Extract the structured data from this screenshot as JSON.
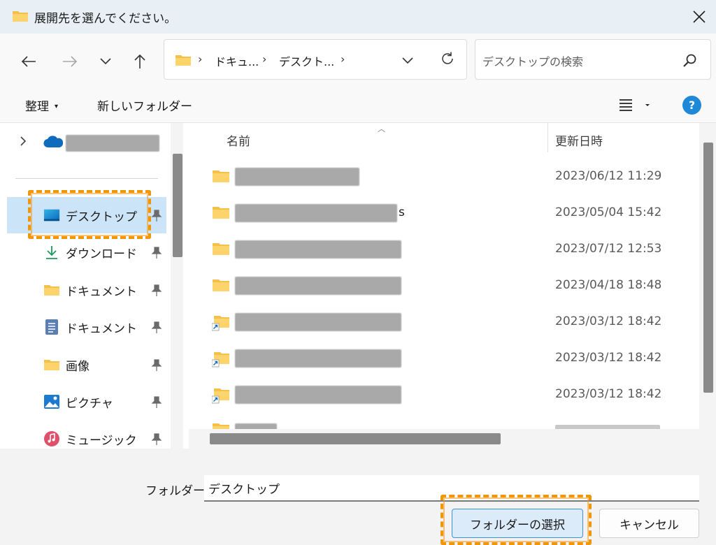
{
  "window": {
    "title": "展開先を選んでください。"
  },
  "navigation": {
    "back_icon": "arrow-left-icon",
    "forward_icon": "arrow-right-icon",
    "recent_icon": "chevron-down-icon",
    "up_icon": "arrow-up-icon"
  },
  "address_bar": {
    "segments": [
      "ドキュ...",
      "デスクト..."
    ]
  },
  "search": {
    "placeholder": "デスクトップの検索"
  },
  "command_bar": {
    "organize_label": "整理",
    "new_folder_label": "新しいフォルダー"
  },
  "nav_pane": {
    "items": [
      {
        "label": "デスクトップ",
        "icon": "desktop-icon",
        "pinned": true
      },
      {
        "label": "ダウンロード",
        "icon": "download-icon",
        "pinned": true
      },
      {
        "label": "ドキュメント",
        "icon": "folder-icon",
        "pinned": true
      },
      {
        "label": "ドキュメント",
        "icon": "document-icon",
        "pinned": true
      },
      {
        "label": "画像",
        "icon": "folder-icon",
        "pinned": true
      },
      {
        "label": "ピクチャ",
        "icon": "pictures-icon",
        "pinned": true
      },
      {
        "label": "ミュージック",
        "icon": "music-icon",
        "pinned": true
      }
    ]
  },
  "file_list": {
    "columns": {
      "name": "名前",
      "modified": "更新日時"
    },
    "rows": [
      {
        "modified": "2023/06/12 11:29",
        "shortcut": false
      },
      {
        "modified": "2023/05/04 15:42",
        "shortcut": false,
        "name_tail": "s"
      },
      {
        "modified": "2023/07/12 12:53",
        "shortcut": false
      },
      {
        "modified": "2023/04/18 18:48",
        "shortcut": false
      },
      {
        "modified": "2023/03/12 18:42",
        "shortcut": true
      },
      {
        "modified": "2023/03/12 18:42",
        "shortcut": true
      },
      {
        "modified": "2023/03/12 18:42",
        "shortcut": true
      }
    ]
  },
  "footer": {
    "folder_label": "フォルダー:",
    "folder_value": "デスクトップ",
    "select_button": "フォルダーの選択",
    "cancel_button": "キャンセル"
  },
  "colors": {
    "accent": "#1e88d9",
    "highlight": "#f0960a",
    "selection": "#cce4f7"
  }
}
